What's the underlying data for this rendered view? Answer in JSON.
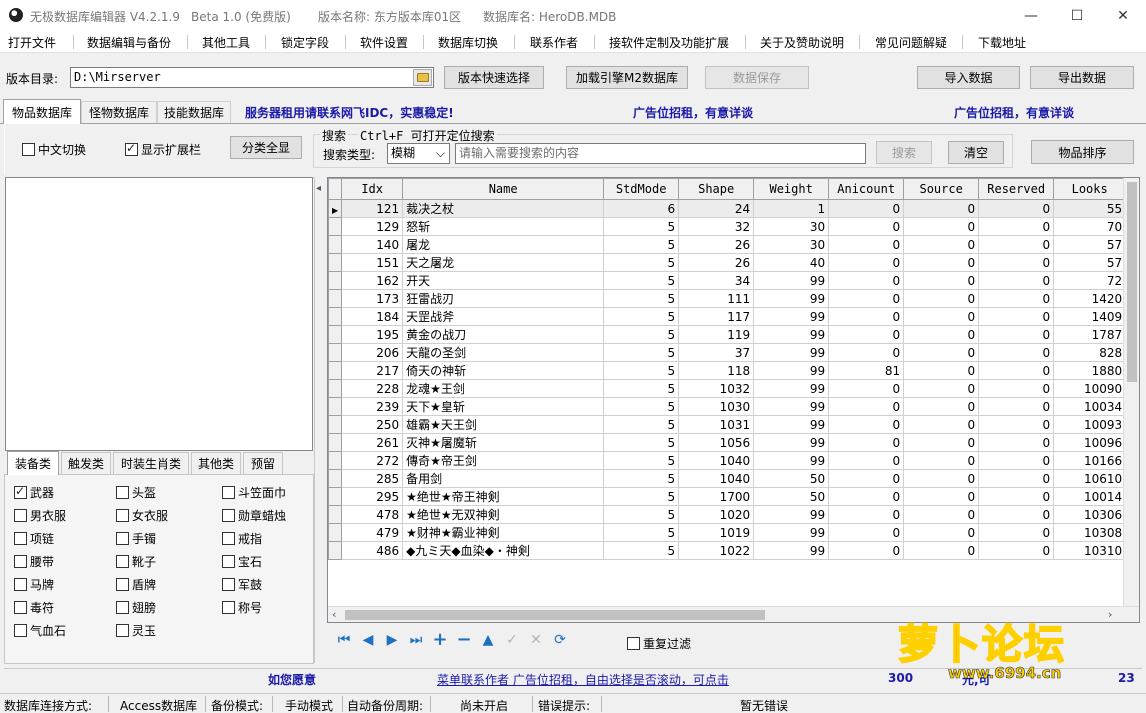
{
  "window": {
    "app_title": "无极数据库编辑器 V4.2.1.9",
    "beta": "Beta 1.0 (免费版)",
    "version_name": "版本名称: 东方版本库01区",
    "db_name": "数据库名: HeroDB.MDB",
    "minimize": "—",
    "maximize": "☐",
    "close": "✕"
  },
  "menu": [
    "打开文件",
    "数据编辑与备份",
    "其他工具",
    "锁定字段",
    "软件设置",
    "数据库切换",
    "联系作者",
    "接软件定制及功能扩展",
    "关于及赞助说明",
    "常见问题解疑",
    "下载地址"
  ],
  "version_row": {
    "label": "版本目录:",
    "path": "D:\\Mirserver",
    "quick_select": "版本快速选择",
    "load_engine": "加载引擎M2数据库",
    "save": "数据保存",
    "import": "导入数据",
    "export": "导出数据"
  },
  "tabs": [
    "物品数据库",
    "怪物数据库",
    "技能数据库"
  ],
  "banners": [
    "服务器租用请联系网飞IDC，实惠稳定!",
    "广告位招租，有意详谈",
    "广告位招租，有意详谈"
  ],
  "options": {
    "cn_switch": "中文切换",
    "show_ext": "显示扩展栏",
    "show_all": "分类全显",
    "search_title": "搜索",
    "search_hint": "Ctrl+F 可打开定位搜索",
    "search_type_label": "搜索类型:",
    "search_type_value": "模糊",
    "search_placeholder": "请输入需要搜索的内容",
    "search_btn": "搜索",
    "clear_btn": "清空",
    "sort_btn": "物品排序"
  },
  "categories": [
    "装备类",
    "触发类",
    "时装生肖类",
    "其他类",
    "预留"
  ],
  "equip_types": [
    {
      "label": "武器",
      "checked": true
    },
    {
      "label": "头盔",
      "checked": false
    },
    {
      "label": "斗笠面巾",
      "checked": false
    },
    {
      "label": "男衣服",
      "checked": false
    },
    {
      "label": "女衣服",
      "checked": false
    },
    {
      "label": "勋章蜡烛",
      "checked": false
    },
    {
      "label": "项链",
      "checked": false
    },
    {
      "label": "手镯",
      "checked": false
    },
    {
      "label": "戒指",
      "checked": false
    },
    {
      "label": "腰带",
      "checked": false
    },
    {
      "label": "靴子",
      "checked": false
    },
    {
      "label": "宝石",
      "checked": false
    },
    {
      "label": "马牌",
      "checked": false
    },
    {
      "label": "盾牌",
      "checked": false
    },
    {
      "label": "军鼓",
      "checked": false
    },
    {
      "label": "毒符",
      "checked": false
    },
    {
      "label": "翅膀",
      "checked": false
    },
    {
      "label": "称号",
      "checked": false
    },
    {
      "label": "气血石",
      "checked": false
    },
    {
      "label": "灵玉",
      "checked": false
    }
  ],
  "table": {
    "columns": [
      "Idx",
      "Name",
      "StdMode",
      "Shape",
      "Weight",
      "Anicount",
      "Source",
      "Reserved",
      "Looks"
    ],
    "rows": [
      [
        "121",
        "裁决之杖",
        "6",
        "24",
        "1",
        "0",
        "0",
        "0",
        "55"
      ],
      [
        "129",
        "怒斩",
        "5",
        "32",
        "30",
        "0",
        "0",
        "0",
        "70"
      ],
      [
        "140",
        "屠龙",
        "5",
        "26",
        "30",
        "0",
        "0",
        "0",
        "57"
      ],
      [
        "151",
        "天之屠龙",
        "5",
        "26",
        "40",
        "0",
        "0",
        "0",
        "57"
      ],
      [
        "162",
        "开天",
        "5",
        "34",
        "99",
        "0",
        "0",
        "0",
        "72"
      ],
      [
        "173",
        "狂雷战刃",
        "5",
        "111",
        "99",
        "0",
        "0",
        "0",
        "1420"
      ],
      [
        "184",
        "天罡战斧",
        "5",
        "117",
        "99",
        "0",
        "0",
        "0",
        "1409"
      ],
      [
        "195",
        "黄金の战刀",
        "5",
        "119",
        "99",
        "0",
        "0",
        "0",
        "1787"
      ],
      [
        "206",
        "天龍の圣剑",
        "5",
        "37",
        "99",
        "0",
        "0",
        "0",
        "828"
      ],
      [
        "217",
        "倚天の神斩",
        "5",
        "118",
        "99",
        "81",
        "0",
        "0",
        "1880"
      ],
      [
        "228",
        "龙魂★王剑",
        "5",
        "1032",
        "99",
        "0",
        "0",
        "0",
        "10090"
      ],
      [
        "239",
        "天下★皇斩",
        "5",
        "1030",
        "99",
        "0",
        "0",
        "0",
        "10034"
      ],
      [
        "250",
        "雄霸★天王剑",
        "5",
        "1031",
        "99",
        "0",
        "0",
        "0",
        "10093"
      ],
      [
        "261",
        "灭神★屠魔斩",
        "5",
        "1056",
        "99",
        "0",
        "0",
        "0",
        "10096"
      ],
      [
        "272",
        "傳奇★帝王剑",
        "5",
        "1040",
        "99",
        "0",
        "0",
        "0",
        "10166"
      ],
      [
        "285",
        "备用剑",
        "5",
        "1040",
        "50",
        "0",
        "0",
        "0",
        "10610"
      ],
      [
        "295",
        "★绝世★帝王神剣",
        "5",
        "1700",
        "50",
        "0",
        "0",
        "0",
        "10014"
      ],
      [
        "478",
        "★绝世★无双神剣",
        "5",
        "1020",
        "99",
        "0",
        "0",
        "0",
        "10306"
      ],
      [
        "479",
        "★财神★霸业神剣",
        "5",
        "1019",
        "99",
        "0",
        "0",
        "0",
        "10308"
      ],
      [
        "486",
        "◆九ミ天◆血染◆・神剣",
        "5",
        "1022",
        "99",
        "0",
        "0",
        "0",
        "10310"
      ]
    ]
  },
  "nav_icons": [
    "first-icon",
    "prev-icon",
    "next-icon",
    "last-icon",
    "insert-icon",
    "delete-icon",
    "edit-icon",
    "post-icon",
    "cancel-icon",
    "refresh-icon"
  ],
  "repeat_filter": "重复过滤",
  "bottom_banner": {
    "left": "如您愿意",
    "middle": "菜单联系作者  广告位招租，自由选择是否滚动，可点击",
    "right_prefix": "300",
    "right_mid": "元,可",
    "right_suffix": "23"
  },
  "watermark": {
    "brand": "萝卜论坛",
    "url": "www.6994.cn"
  },
  "status": {
    "conn_label": "数据库连接方式:",
    "conn_value": "Access数据库",
    "backup_mode_label": "备份模式:",
    "backup_mode_value": "手动模式",
    "auto_backup_label": "自动备份周期:",
    "auto_backup_value": "尚未开启",
    "error_label": "错误提示:",
    "error_value": "暂无错误"
  }
}
